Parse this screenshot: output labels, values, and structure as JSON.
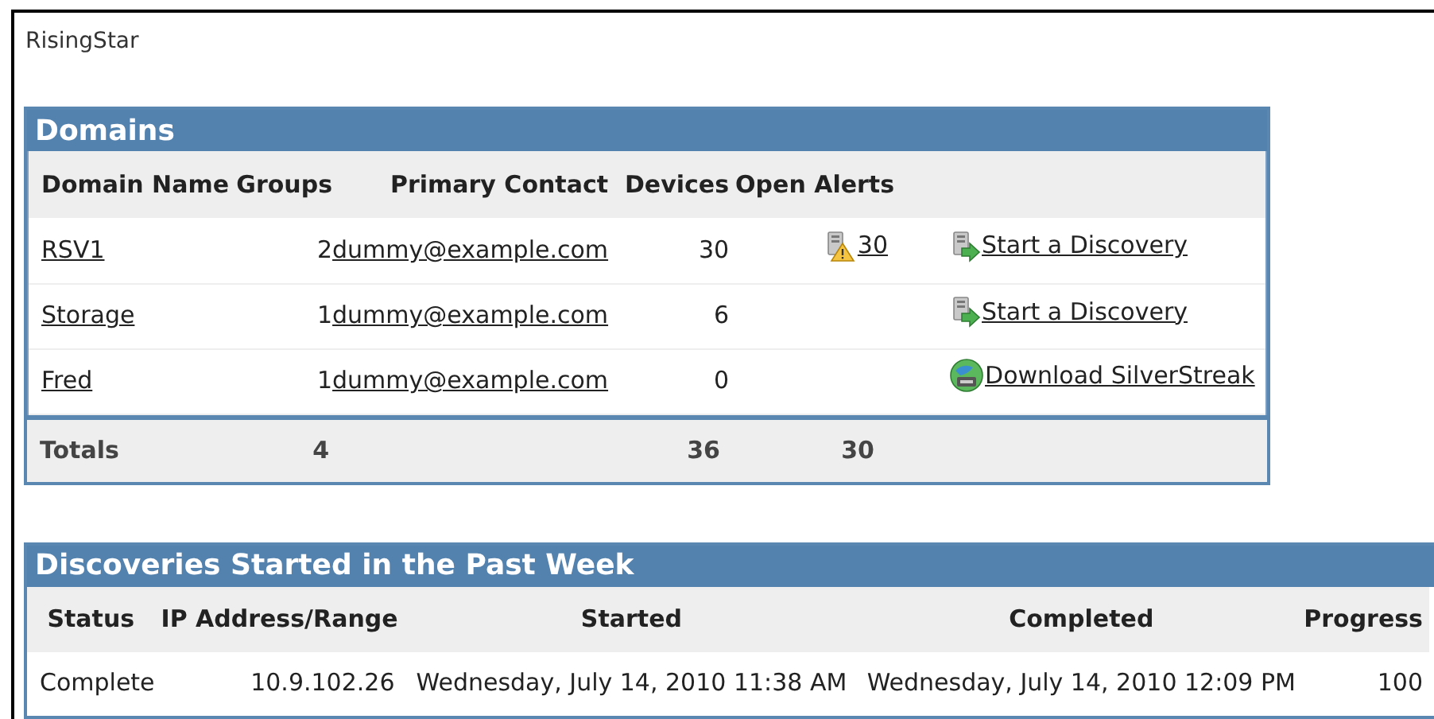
{
  "app_title": "RisingStar",
  "domains": {
    "title": "Domains",
    "columns": [
      "Domain Name",
      "Groups",
      "Primary Contact",
      "Devices",
      "Open Alerts"
    ],
    "rows": [
      {
        "name": "RSV1",
        "groups": "2",
        "contact": "dummy@example.com",
        "devices": "30",
        "alerts": "30",
        "action": {
          "kind": "discovery",
          "label": "Start a Discovery"
        }
      },
      {
        "name": "Storage",
        "groups": "1",
        "contact": "dummy@example.com",
        "devices": "6",
        "action": {
          "kind": "discovery",
          "label": "Start a Discovery"
        }
      },
      {
        "name": "Fred",
        "groups": "1",
        "contact": "dummy@example.com",
        "devices": "0",
        "action": {
          "kind": "download",
          "label": "Download SilverStreak"
        }
      }
    ],
    "totals": {
      "label": "Totals",
      "groups": "4",
      "devices": "36",
      "alerts": "30"
    }
  },
  "discoveries": {
    "title": "Discoveries Started in the Past Week",
    "columns": [
      "Status",
      "IP Address/Range",
      "Started",
      "Completed",
      "Progress"
    ],
    "rows": [
      {
        "status": "Complete",
        "ip": "10.9.102.26",
        "started": "Wednesday, July 14, 2010 11:38 AM",
        "completed": "Wednesday, July 14, 2010 12:09 PM",
        "progress": "100"
      }
    ]
  }
}
